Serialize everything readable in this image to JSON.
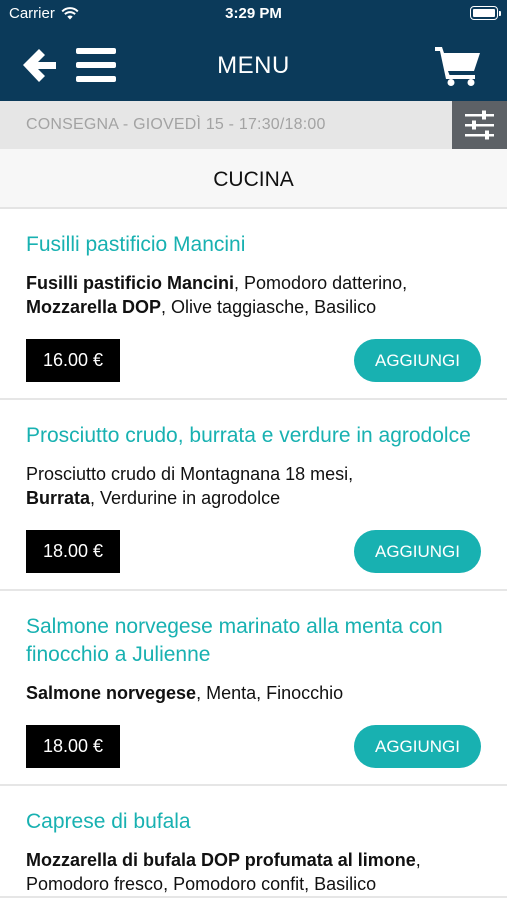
{
  "status_bar": {
    "carrier": "Carrier",
    "time": "3:29 PM"
  },
  "navbar": {
    "title": "MENU"
  },
  "delivery": {
    "text": "CONSEGNA - GIOVEDÌ 15 - 17:30/18:00"
  },
  "section": {
    "title": "CUCINA"
  },
  "products": [
    {
      "name": "Fusilli pastificio Mancini",
      "desc": [
        {
          "bold": "Fusilli pastificio Mancini",
          "rest": ", Pomodoro datterino,"
        },
        {
          "bold": "Mozzarella DOP",
          "rest": ", Olive taggiasche, Basilico"
        }
      ],
      "price": "16.00 €",
      "add_label": "AGGIUNGI"
    },
    {
      "name": "Prosciutto crudo, burrata e verdure in agrodolce",
      "desc": [
        {
          "bold": "",
          "rest": "Prosciutto crudo di Montagnana 18 mesi,"
        },
        {
          "bold": "Burrata",
          "rest": ", Verdurine in agrodolce"
        }
      ],
      "price": "18.00 €",
      "add_label": "AGGIUNGI"
    },
    {
      "name": "Salmone norvegese marinato alla menta con finocchio a Julienne",
      "desc": [
        {
          "bold": "Salmone norvegese",
          "rest": ", Menta, Finocchio"
        }
      ],
      "price": "18.00 €",
      "add_label": "AGGIUNGI"
    },
    {
      "name": "Caprese di bufala",
      "desc": [
        {
          "bold": "Mozzarella di bufala DOP profumata al limone",
          "rest": ","
        },
        {
          "bold": "",
          "rest": "Pomodoro fresco, Pomodoro confit, Basilico"
        }
      ],
      "price": "",
      "add_label": ""
    }
  ],
  "colors": {
    "navbar": "#0b3a5a",
    "accent": "#18b1b1",
    "filter": "#5d6166"
  },
  "icons": {
    "back": "arrow-left-icon",
    "menu": "hamburger-icon",
    "cart": "cart-icon",
    "filter": "sliders-icon",
    "wifi": "wifi-icon",
    "battery": "battery-icon"
  }
}
